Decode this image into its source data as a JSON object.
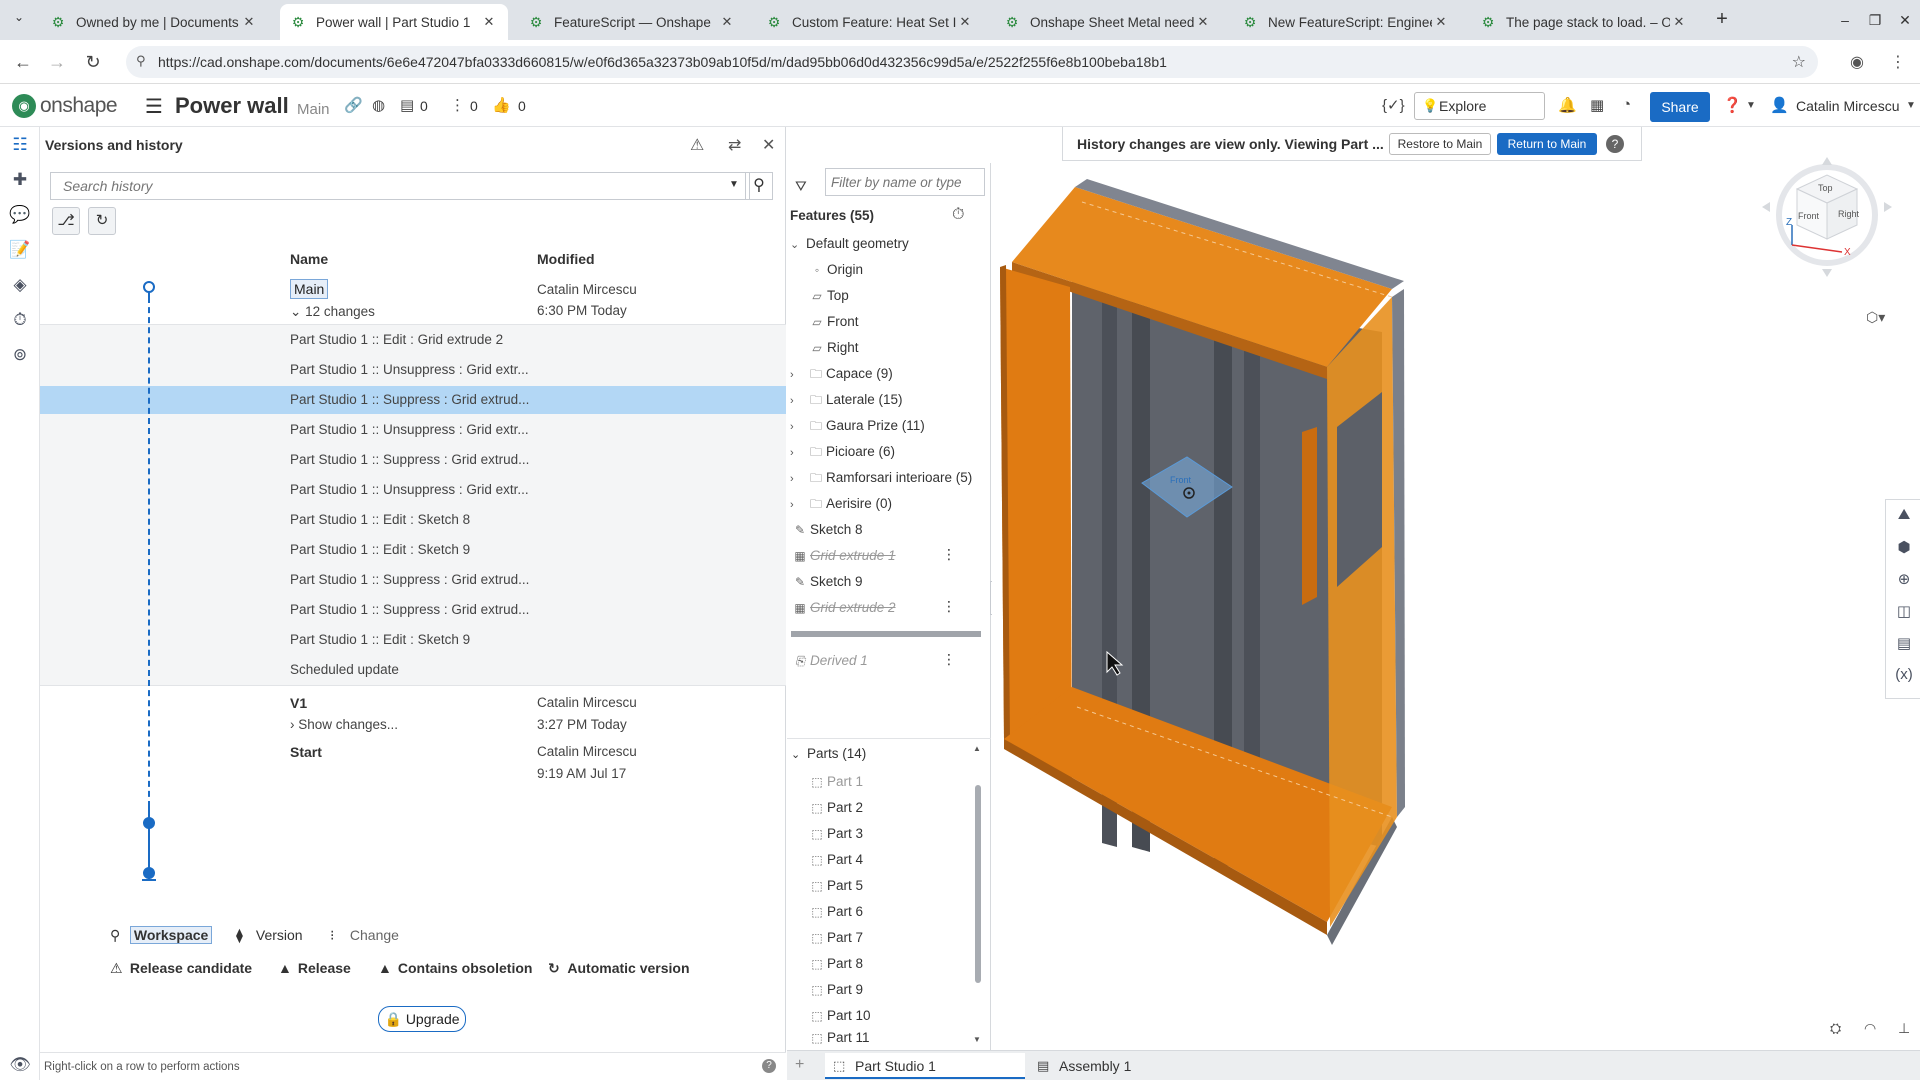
{
  "browser": {
    "tabs": [
      {
        "label": "Owned by me | Documents",
        "active": false
      },
      {
        "label": "Power wall | Part Studio 1",
        "active": true
      },
      {
        "label": "FeatureScript — Onshape",
        "active": false
      },
      {
        "label": "Custom Feature: Heat Set In",
        "active": false
      },
      {
        "label": "Onshape Sheet Metal needs",
        "active": false
      },
      {
        "label": "New FeatureScript: Engineer",
        "active": false
      },
      {
        "label": "The page stack to load. – On",
        "active": false
      }
    ],
    "url": "https://cad.onshape.com/documents/6e6e472047bfa0333d660815/w/e0f6d365a32373b09ab10f5d/m/dad95bb06d0d432356c99d5a/e/2522f255f6e8b100beba18b1"
  },
  "header": {
    "logo_text": "onshape",
    "doc_title": "Power wall",
    "branch": "Main",
    "count_versions": "0",
    "count_branches": "0",
    "count_likes": "0",
    "explore_label": "Explore Onshape",
    "share_label": "Share",
    "user_name": "Catalin Mircescu"
  },
  "versions_panel": {
    "title": "Versions and history",
    "search_placeholder": "Search history",
    "col_name": "Name",
    "col_modified": "Modified",
    "main": {
      "name": "Main",
      "changes_label": "12 changes",
      "author": "Catalin Mircescu",
      "time": "6:30 PM Today"
    },
    "changes": [
      "Part Studio 1 :: Edit : Grid extrude 2",
      "Part Studio 1 :: Unsuppress : Grid extr...",
      "Part Studio 1 :: Suppress : Grid extrud...",
      "Part Studio 1 :: Unsuppress : Grid extr...",
      "Part Studio 1 :: Suppress : Grid extrud...",
      "Part Studio 1 :: Unsuppress : Grid extr...",
      "Part Studio 1 :: Edit : Sketch 8",
      "Part Studio 1 :: Edit : Sketch 9",
      "Part Studio 1 :: Suppress : Grid extrud...",
      "Part Studio 1 :: Suppress : Grid extrud...",
      "Part Studio 1 :: Edit : Sketch 9",
      "Scheduled update"
    ],
    "selected_change_index": 2,
    "v1": {
      "name": "V1",
      "show_changes": "Show changes...",
      "author": "Catalin Mircescu",
      "time": "3:27 PM Today"
    },
    "start": {
      "name": "Start",
      "author": "Catalin Mircescu",
      "time": "9:19 AM Jul 17"
    },
    "legend": {
      "workspace": "Workspace",
      "version": "Version",
      "change": "Change",
      "release_candidate": "Release candidate",
      "release": "Release",
      "contains_obsoletion": "Contains obsoletion",
      "automatic_version": "Automatic version"
    },
    "upgrade_label": "Upgrade",
    "status_text": "Right-click on a row to perform actions"
  },
  "feature_list": {
    "filter_placeholder": "Filter by name or type",
    "features_header": "Features (55)",
    "default_geometry": "Default geometry",
    "origin": "Origin",
    "planes": [
      "Top",
      "Front",
      "Right"
    ],
    "folders": [
      "Capace (9)",
      "Laterale (15)",
      "Gaura Prize (11)",
      "Picioare (6)",
      "Ramforsari interioare (5)",
      "Aerisire (0)"
    ],
    "sketch8": "Sketch 8",
    "grid_extrude_1": "Grid extrude 1",
    "sketch9": "Sketch 9",
    "grid_extrude_2": "Grid extrude 2",
    "derived1": "Derived 1",
    "parts_header": "Parts (14)",
    "parts": [
      "Part 1",
      "Part 2",
      "Part 3",
      "Part 4",
      "Part 5",
      "Part 6",
      "Part 7",
      "Part 8",
      "Part 9",
      "Part 10",
      "Part 11"
    ]
  },
  "viewport": {
    "banner_text": "History changes are view only. Viewing Part ...",
    "restore_label": "Restore to Main",
    "return_label": "Return to Main",
    "cube_top": "Top",
    "cube_front": "Front",
    "cube_right": "Right",
    "axis_z": "Z",
    "axis_x": "X",
    "plane_label": "Front"
  },
  "bottom_tabs": {
    "part_studio": "Part Studio 1",
    "assembly": "Assembly 1"
  },
  "colors": {
    "accent": "#1a6bc4",
    "selection": "#b3d7f5",
    "model_orange": "#e07b12",
    "model_gray": "#5c6068"
  }
}
